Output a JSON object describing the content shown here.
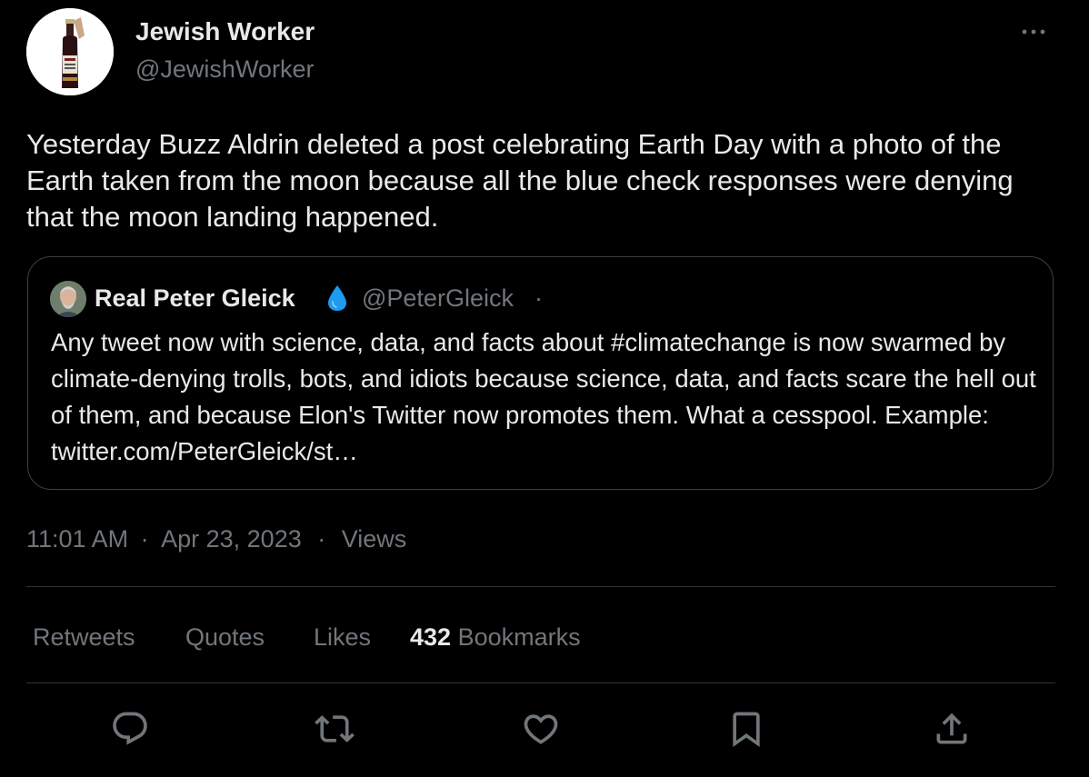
{
  "author": {
    "name": "Jewish Worker",
    "handle": "@JewishWorker"
  },
  "tweet": {
    "text": "Yesterday Buzz Aldrin deleted a post celebrating Earth Day with a photo of the Earth taken from the moon because all the blue check responses were denying that the moon landing happened."
  },
  "quoted_tweet": {
    "name": "Real Peter Gleick",
    "handle": "@PeterGleick",
    "separator": "·",
    "text": "Any tweet now with science, data, and facts about #climatechange is now swarmed by climate-denying trolls, bots, and idiots because science, data, and facts scare the hell out of them, and because Elon's Twitter now promotes them. What a cesspool. Example: twitter.com/PeterGleick/st…"
  },
  "meta": {
    "time": "11:01 AM",
    "sep1": "·",
    "date": "Apr 23, 2023",
    "sep2": "·",
    "views_label": "Views"
  },
  "stats": {
    "retweets_label": "Retweets",
    "quotes_label": "Quotes",
    "likes_label": "Likes",
    "bookmarks_count": "432",
    "bookmarks_label": "Bookmarks"
  },
  "actions": [
    "reply-icon",
    "retweet-icon",
    "like-icon",
    "bookmark-icon",
    "share-icon"
  ],
  "colors": {
    "background": "#000000",
    "text_primary": "#e7e9ea",
    "text_secondary": "#71767b",
    "border": "#2f3336",
    "drop_icon": "#1d9bf0"
  }
}
